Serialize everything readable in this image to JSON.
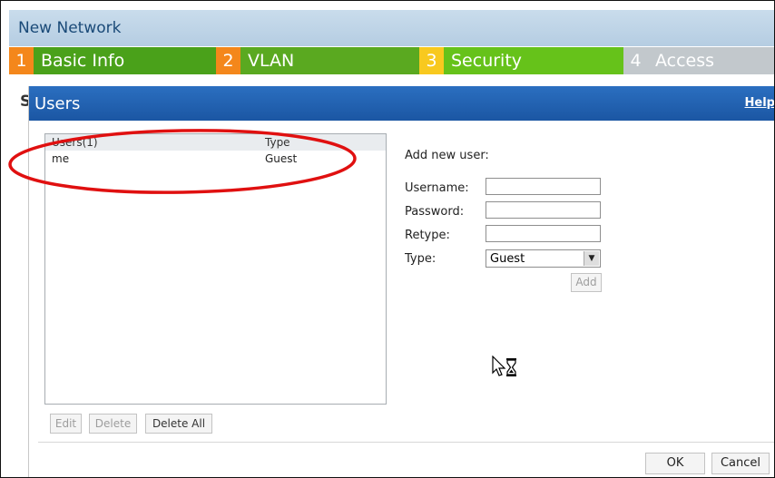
{
  "header": {
    "title": "New Network"
  },
  "tabs": [
    {
      "num": "1",
      "label": "Basic Info"
    },
    {
      "num": "2",
      "label": "VLAN"
    },
    {
      "num": "3",
      "label": "Security"
    },
    {
      "num": "4",
      "label": "Access"
    }
  ],
  "background_partial_letter": "S",
  "dialog": {
    "title": "Users",
    "help": "Help",
    "list": {
      "headers": [
        "Users(1)",
        "Type"
      ],
      "rows": [
        {
          "user": "me",
          "type": "Guest"
        }
      ]
    },
    "list_buttons": {
      "edit": "Edit",
      "delete": "Delete",
      "delete_all": "Delete All"
    },
    "form": {
      "heading": "Add new user:",
      "username_label": "Username:",
      "password_label": "Password:",
      "retype_label": "Retype:",
      "type_label": "Type:",
      "username_value": "",
      "password_value": "",
      "retype_value": "",
      "type_value": "Guest",
      "add_label": "Add"
    },
    "footer": {
      "ok": "OK",
      "cancel": "Cancel"
    }
  },
  "colors": {
    "tab_green": "#4aa11a",
    "tab_lime": "#66c21a",
    "tab_orange": "#f4871b",
    "tab_yellow": "#f8c91f",
    "tab_gray": "#c2c8cc",
    "title_blue": "#1b56a3",
    "annotation_red": "#e01010"
  }
}
